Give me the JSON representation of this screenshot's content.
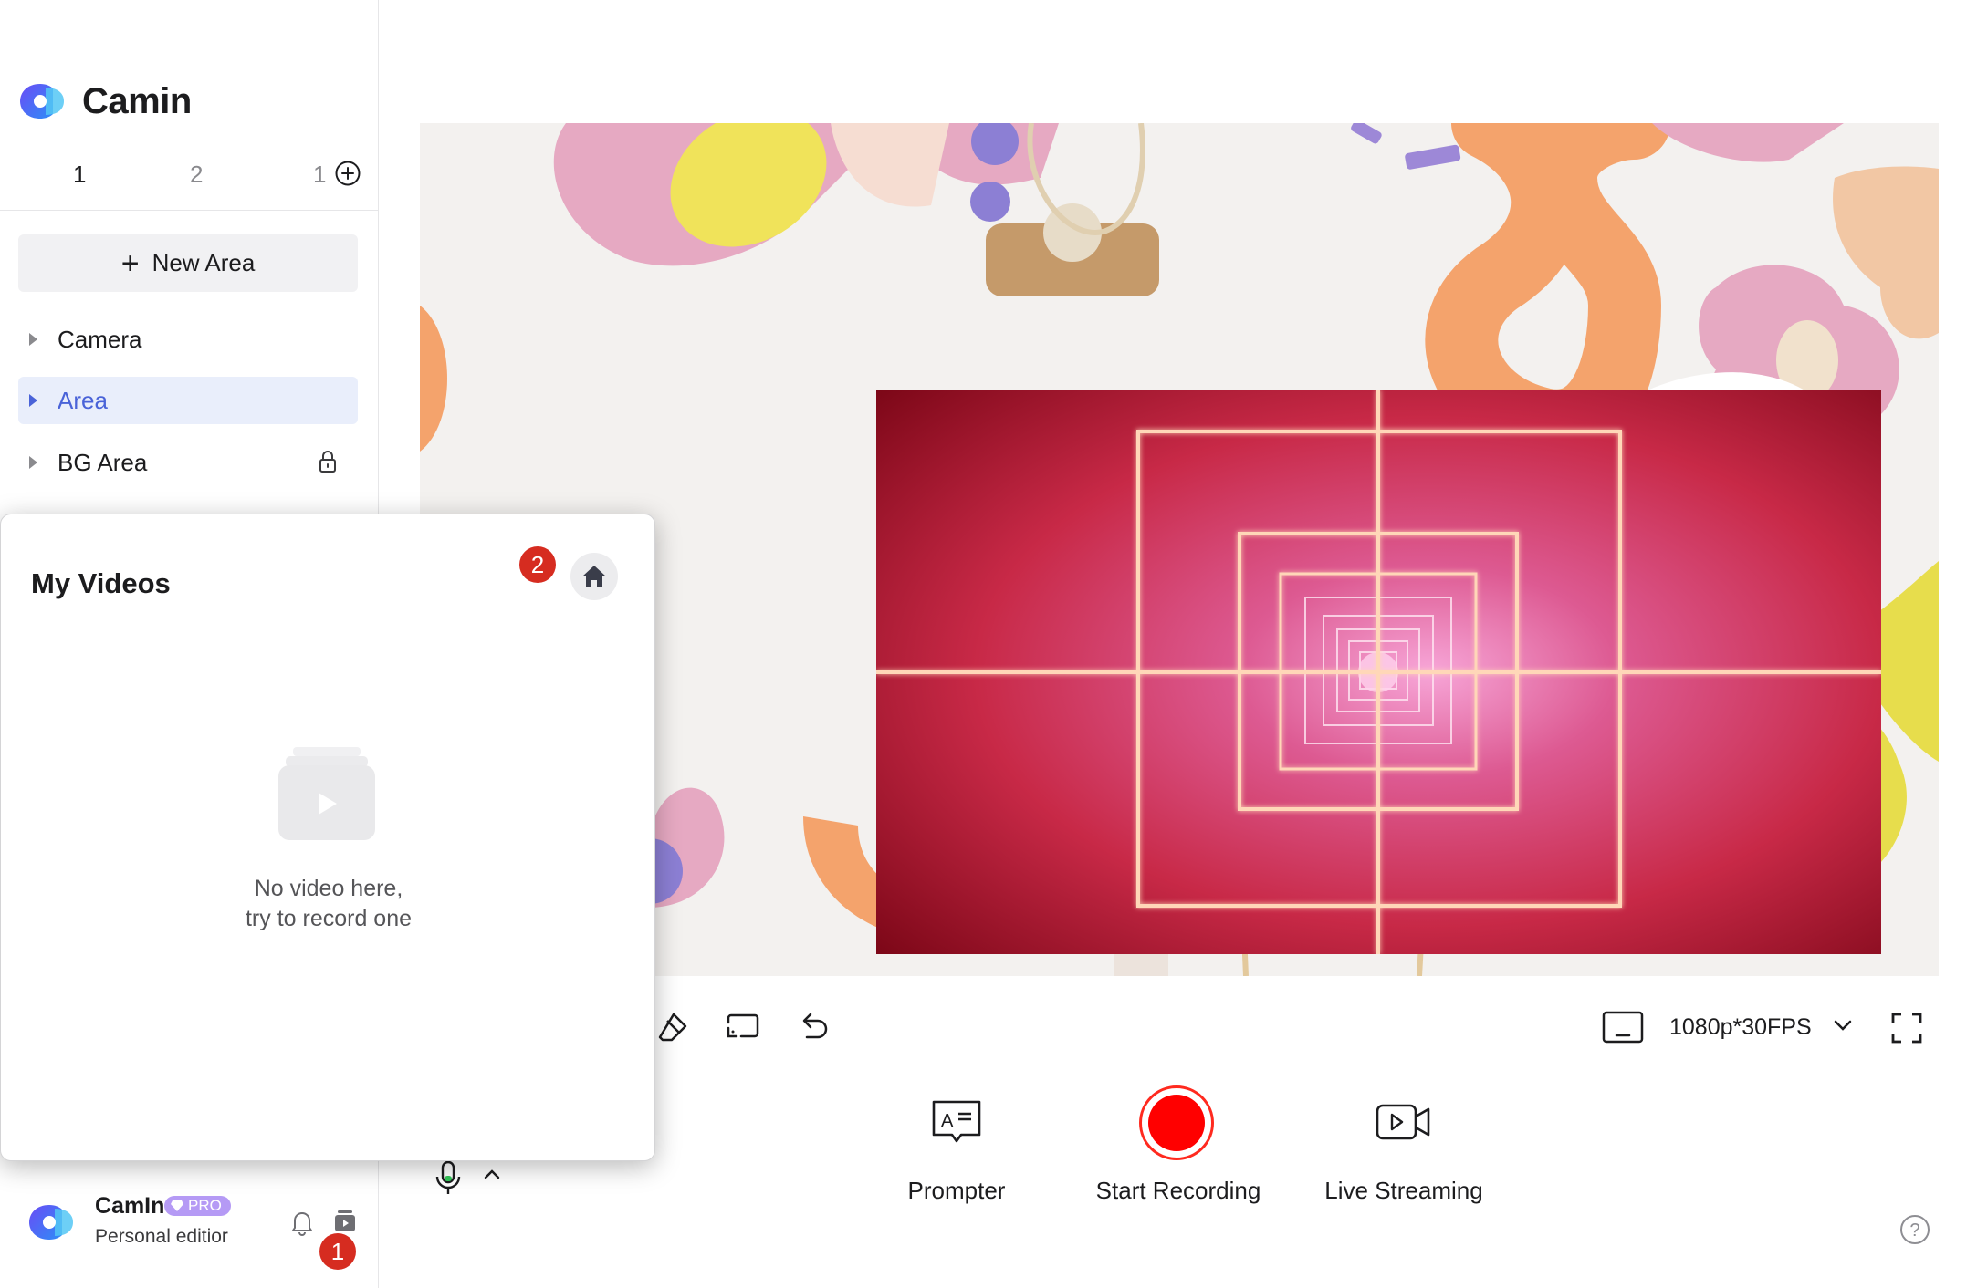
{
  "window": {
    "controls": [
      "close",
      "minimize",
      "maximize"
    ]
  },
  "sidebar": {
    "app_name": "Camin",
    "scene_tabs": [
      "1",
      "2",
      "1"
    ],
    "new_area_label": "New Area",
    "tree": [
      {
        "label": "Camera",
        "selected": false,
        "locked": false
      },
      {
        "label": "Area",
        "selected": true,
        "locked": false
      },
      {
        "label": "BG Area",
        "selected": false,
        "locked": true
      }
    ],
    "user": {
      "name": "CamIn",
      "badge": "PRO",
      "plan": "Personal editior"
    },
    "videos_badge": "1"
  },
  "toolbar": {
    "resolution": "1080p*30FPS",
    "icons": [
      "eraser-icon",
      "screen-area-icon",
      "undo-icon",
      "screen-icon",
      "chevron-down-icon",
      "fullscreen-icon"
    ]
  },
  "actions": {
    "prompter": "Prompter",
    "record": "Start Recording",
    "live": "Live Streaming"
  },
  "popup": {
    "title": "My Videos",
    "step_badge": "2",
    "empty_line1": "No video here,",
    "empty_line2": "try to record one"
  },
  "colors": {
    "accent": "#4a63d8",
    "record": "#ff0000",
    "badge": "#d62c20",
    "pro": "#b59af5"
  }
}
